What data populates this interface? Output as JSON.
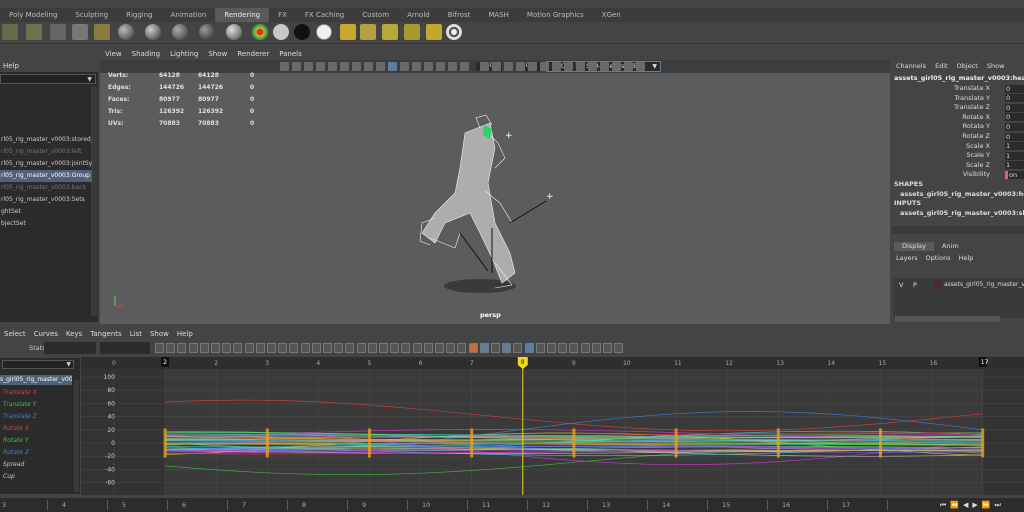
{
  "shelf_tabs": [
    "Poly Modeling",
    "Sculpting",
    "Rigging",
    "Animation",
    "Rendering",
    "FX",
    "FX Caching",
    "Custom",
    "Arnold",
    "Bifrost",
    "MASH",
    "Motion Graphics",
    "XGen"
  ],
  "active_shelf_tab": "Rendering",
  "outliner": {
    "help_label": "Help",
    "items": [
      {
        "label": "rl05_rig_master_v0003:stored_t",
        "dim": false,
        "sel": false
      },
      {
        "label": "rl05_rig_master_v0003:left",
        "dim": true,
        "sel": false
      },
      {
        "label": "rl05_rig_master_v0003:jointSys",
        "dim": false,
        "sel": false
      },
      {
        "label": "rl05_rig_master_v0003:Group",
        "dim": false,
        "sel": true
      },
      {
        "label": "rl05_rig_master_v0003:back",
        "dim": true,
        "sel": false
      },
      {
        "label": "rl05_rig_master_v0003:Sets",
        "dim": false,
        "sel": false
      },
      {
        "label": "ghtSet",
        "dim": false,
        "sel": false
      },
      {
        "label": "bjectSet",
        "dim": false,
        "sel": false
      }
    ]
  },
  "viewport": {
    "menu": [
      "View",
      "Shading",
      "Lighting",
      "Show",
      "Renderer",
      "Panels"
    ],
    "exposure": "0.00",
    "gamma": "1.00",
    "color_space": "ACES 1.0 SDR-video (sRGB)",
    "camera_label": "persp",
    "hud": [
      {
        "label": "Verts:",
        "a": "64128",
        "b": "64128",
        "c": "0"
      },
      {
        "label": "Edges:",
        "a": "144726",
        "b": "144726",
        "c": "0"
      },
      {
        "label": "Faces:",
        "a": "80977",
        "b": "80977",
        "c": "0"
      },
      {
        "label": "Tris:",
        "a": "126392",
        "b": "126392",
        "c": "0"
      },
      {
        "label": "UVs:",
        "a": "70883",
        "b": "70883",
        "c": "0"
      }
    ]
  },
  "channel_box": {
    "menu": [
      "Channels",
      "Edit",
      "Object",
      "Show"
    ],
    "object_name": "assets_girl05_rig_master_v0003:hea",
    "channels": [
      {
        "label": "Translate X",
        "value": "0"
      },
      {
        "label": "Translate Y",
        "value": "0"
      },
      {
        "label": "Translate Z",
        "value": "0"
      },
      {
        "label": "Rotate X",
        "value": "0"
      },
      {
        "label": "Rotate Y",
        "value": "0"
      },
      {
        "label": "Rotate Z",
        "value": "0"
      },
      {
        "label": "Scale X",
        "value": "1"
      },
      {
        "label": "Scale Y",
        "value": "1"
      },
      {
        "label": "Scale Z",
        "value": "1"
      },
      {
        "label": "Visibility",
        "value": "on"
      }
    ],
    "shapes_label": "SHAPES",
    "shapes_item": "assets_girl05_rig_master_v0003:he",
    "inputs_label": "INPUTS",
    "inputs_item": "assets_girl05_rig_master_v0003:sl",
    "layer_tabs": [
      "Display",
      "Anim"
    ],
    "layer_menu": [
      "Layers",
      "Options",
      "Help"
    ],
    "layer_v": "V",
    "layer_p": "P",
    "layer_name": "assets_girl05_rig_master_v000"
  },
  "graph_editor": {
    "menu": [
      "Select",
      "Curves",
      "Keys",
      "Tangents",
      "List",
      "Show",
      "Help"
    ],
    "stats_label": "Stats",
    "object_name": "s_girl05_rig_master_v000",
    "curves": [
      {
        "label": "Translate X",
        "color": "#e04040"
      },
      {
        "label": "Translate Y",
        "color": "#40c040"
      },
      {
        "label": "Translate Z",
        "color": "#4080e0"
      },
      {
        "label": "Rotate X",
        "color": "#e04040"
      },
      {
        "label": "Rotate Y",
        "color": "#40c040"
      },
      {
        "label": "Rotate Z",
        "color": "#4080e0"
      },
      {
        "label": "Spread",
        "color": "#cccccc"
      },
      {
        "label": "Cup",
        "color": "#cccccc"
      }
    ],
    "frames": [
      "0",
      "1",
      "2",
      "3",
      "4",
      "5",
      "6",
      "7",
      "8",
      "9",
      "10",
      "11",
      "12",
      "13",
      "14",
      "15",
      "16",
      "17"
    ],
    "current_frame": "8",
    "range_start_label": "2",
    "range_end_label": "17",
    "y_ticks": [
      "100",
      "80",
      "60",
      "40",
      "20",
      "0",
      "-20",
      "-40",
      "-60"
    ]
  },
  "time_slider": {
    "ticks": [
      "3",
      "4",
      "5",
      "6",
      "7",
      "8",
      "9",
      "10",
      "11",
      "12",
      "13",
      "14",
      "15",
      "16",
      "17"
    ]
  }
}
